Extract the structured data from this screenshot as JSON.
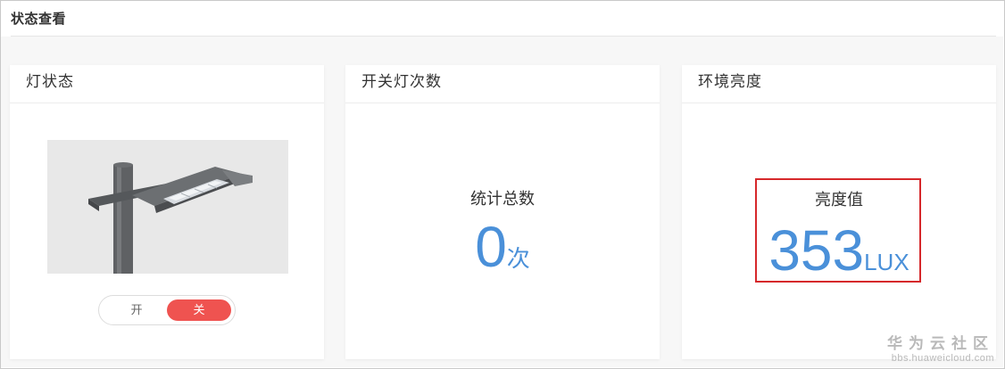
{
  "page": {
    "title": "状态查看"
  },
  "cards": [
    {
      "title": "灯状态",
      "toggle": {
        "on_label": "开",
        "off_label": "关",
        "selected": "关"
      }
    },
    {
      "title": "开关灯次数",
      "stat_label": "统计总数",
      "value": "0",
      "unit": "次"
    },
    {
      "title": "环境亮度",
      "stat_label": "亮度值",
      "value": "353",
      "unit": "LUX"
    }
  ],
  "colors": {
    "accent_blue": "#4a90d9",
    "toggle_active": "#ef5350",
    "highlight_border": "#d6282b"
  },
  "watermark": {
    "title": "华为云社区",
    "url": "bbs.huaweicloud.com"
  }
}
